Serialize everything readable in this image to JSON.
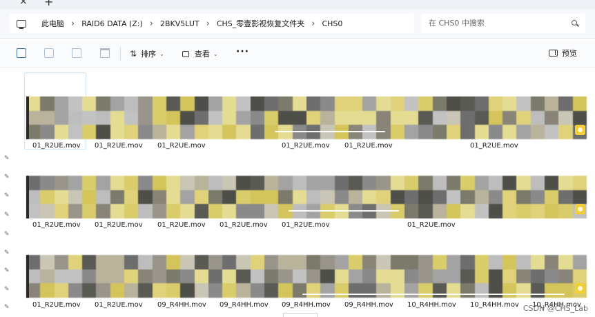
{
  "titlebar": {
    "close_glyph": "×",
    "new_tab_glyph": "+"
  },
  "address": {
    "breadcrumbs": [
      "此电脑",
      "RAID6 DATA (Z:)",
      "2BKV5LUT",
      "CHS_零壹影视恢复文件夹",
      "CHS0"
    ],
    "separator": "›"
  },
  "search": {
    "placeholder": "在 CHS0 中搜索"
  },
  "toolbar": {
    "sort_label": "排序",
    "view_label": "查看",
    "more_label": "···",
    "preview_label": "预览",
    "caret": "⌄"
  },
  "icons": {
    "pc": "computer-icon",
    "search": "search-icon",
    "copy": "copy-icon",
    "rename": "rename-icon",
    "share": "share-icon",
    "delete": "trash-icon",
    "sort": "sort-icon",
    "view": "view-icon",
    "preview": "preview-pane-icon",
    "pin": "pin-icon",
    "video_badge": "video-badge-icon"
  },
  "pin_glyph": "✎",
  "rows": [
    {
      "files": [
        "01_R2UE.mov",
        "01_R2UE.mov",
        "01_R2UE.mov",
        "",
        "01_R2UE.mov",
        "01_R2UE.mov",
        "",
        "01_R2UE.mov"
      ]
    },
    {
      "files": [
        "01_R2UE.mov",
        "01_R2UE.mov",
        "01_R2UE.mov",
        "01_R2UE.mov",
        "01_R2UE.mov",
        "",
        "01_R2UE.mov",
        ""
      ]
    },
    {
      "files": [
        "01_R2UE.mov",
        "01_R2UE.mov",
        "09_R4HH.mov",
        "09_R4HH.mov",
        "09_R4HH.mov",
        "09_R4HH.mov",
        "10_R4HH.mov",
        "10_R4HH.mov",
        "10_R4HH.mov"
      ]
    }
  ],
  "watermark": "CSDN @CHS_Lab",
  "colors": {
    "accent": "#3d6fb0",
    "badge": "#f1cf35",
    "selection": "#cde4f7"
  }
}
